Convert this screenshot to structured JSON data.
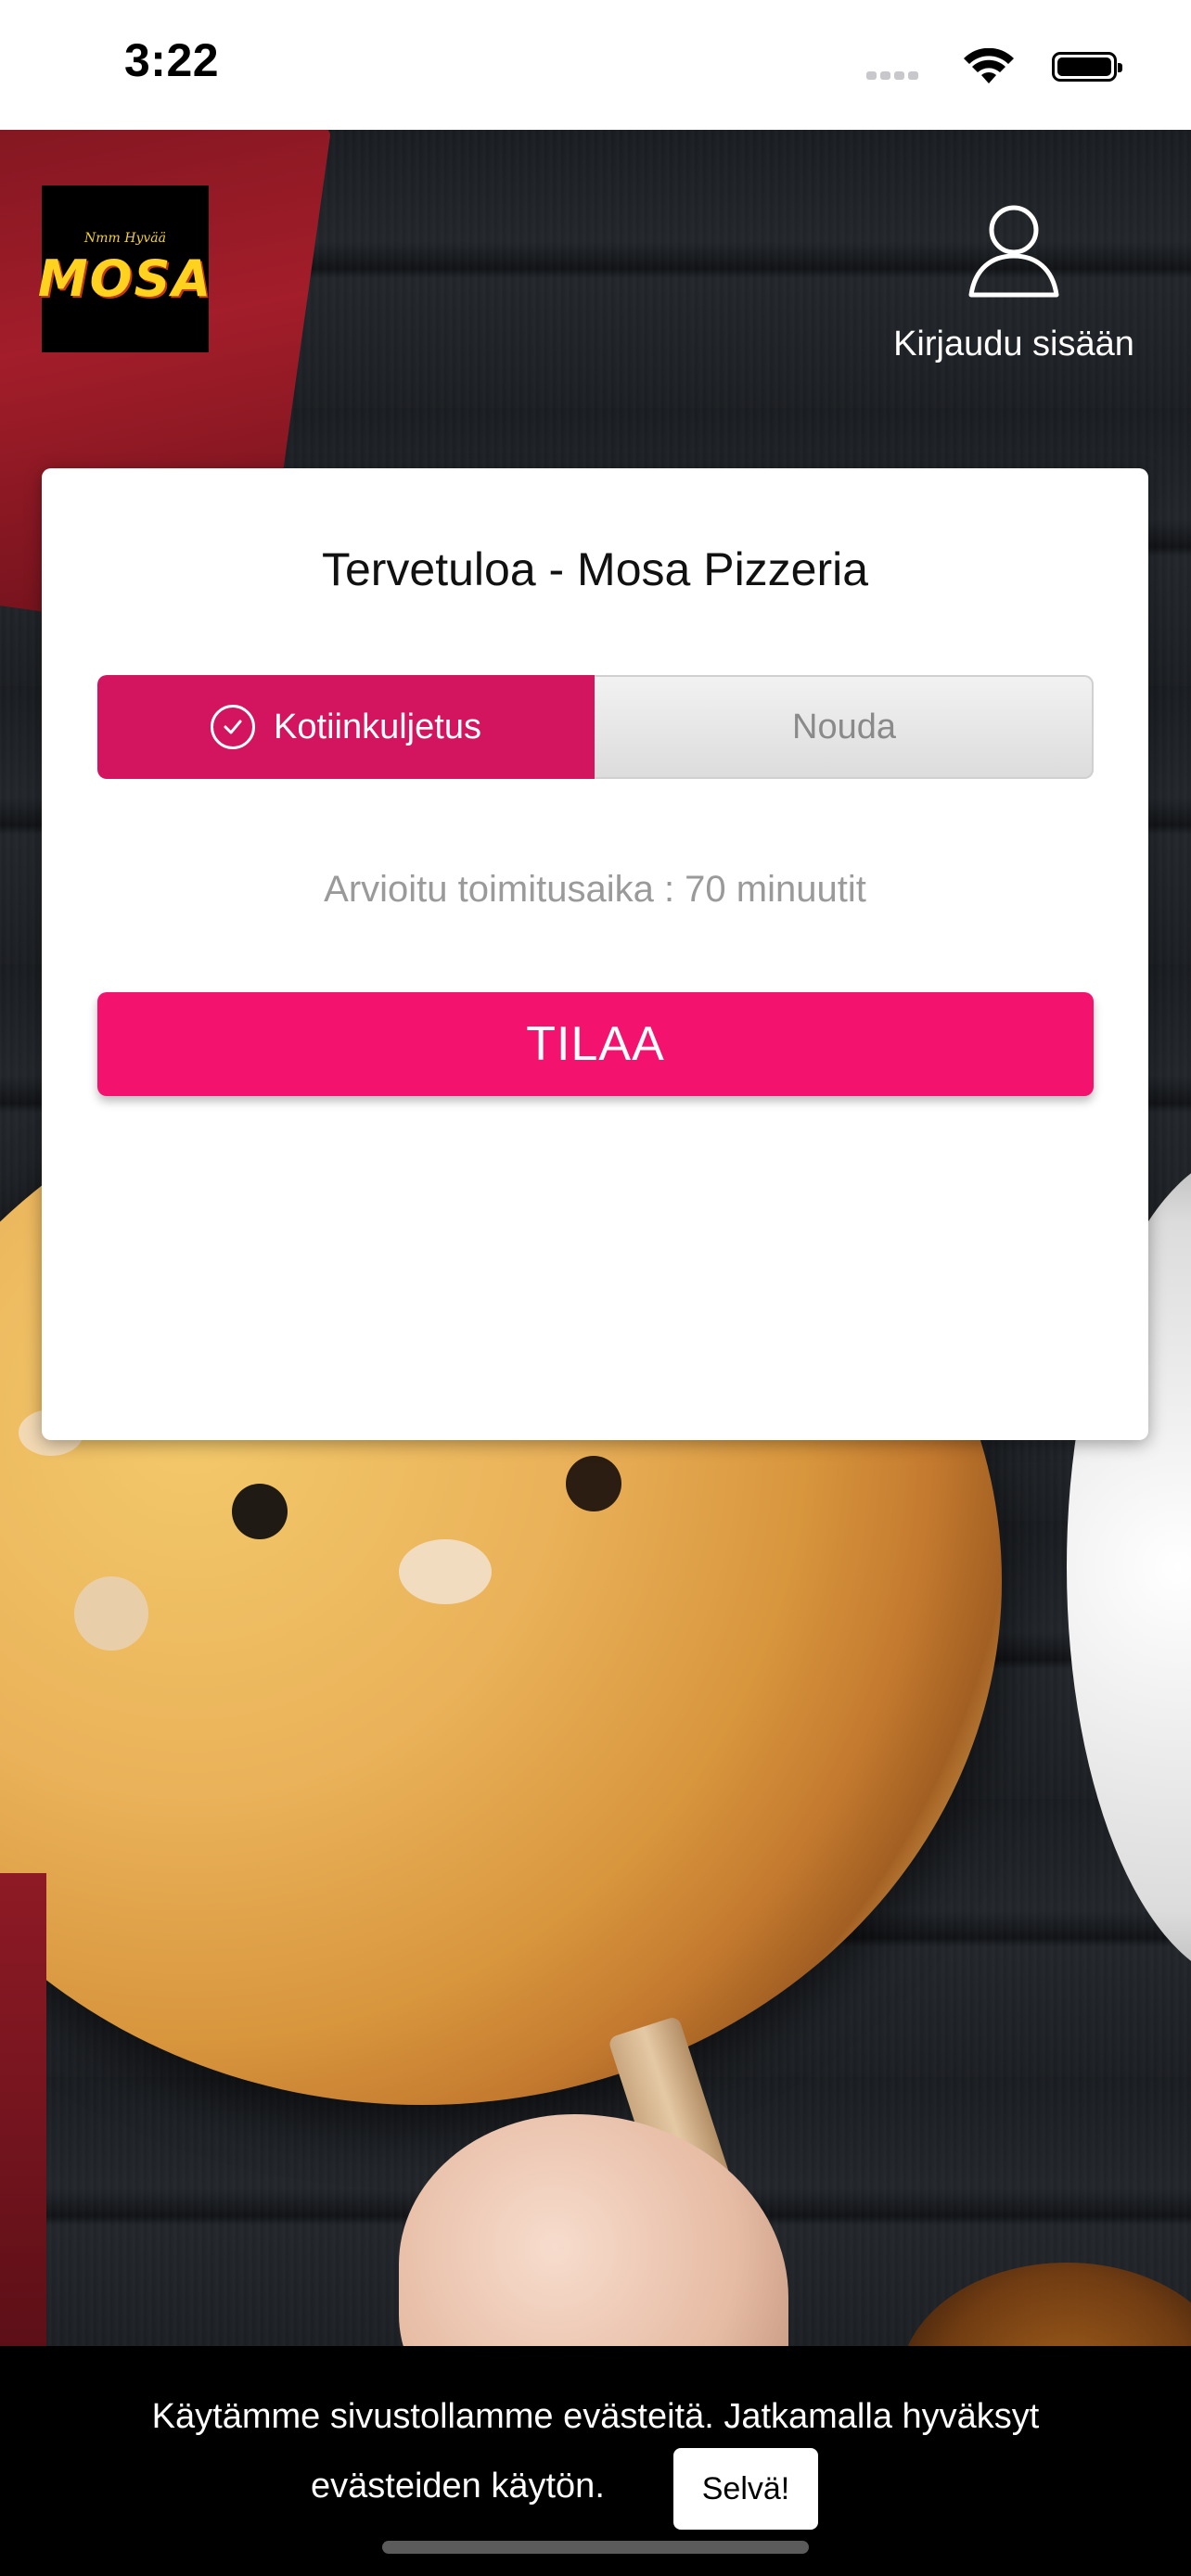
{
  "status_bar": {
    "time": "3:22",
    "icons": [
      "signal-icon",
      "wifi-icon",
      "battery-icon"
    ]
  },
  "header": {
    "logo": {
      "small_text": "Nmm Hyvää",
      "brand": "MOSA"
    },
    "login_label": "Kirjaudu sisään",
    "login_icon": "user-icon"
  },
  "card": {
    "title": "Tervetuloa - Mosa Pizzeria",
    "toggle": {
      "delivery_label": "Kotiinkuljetus",
      "pickup_label": "Nouda",
      "selected": "delivery"
    },
    "eta_text": "Arvioitu toimitusaika : 70 minuutit",
    "order_button": "TILAA"
  },
  "cookie_bar": {
    "text_line1": "Käytämme sivustollamme evästeitä. Jatkamalla hyväksyt",
    "text_line2": "evästeiden käytön.",
    "button": "Selvä!"
  },
  "colors": {
    "accent": "#f3136f",
    "selected_toggle": "#d3145f",
    "cookie_bg": "#000000"
  }
}
